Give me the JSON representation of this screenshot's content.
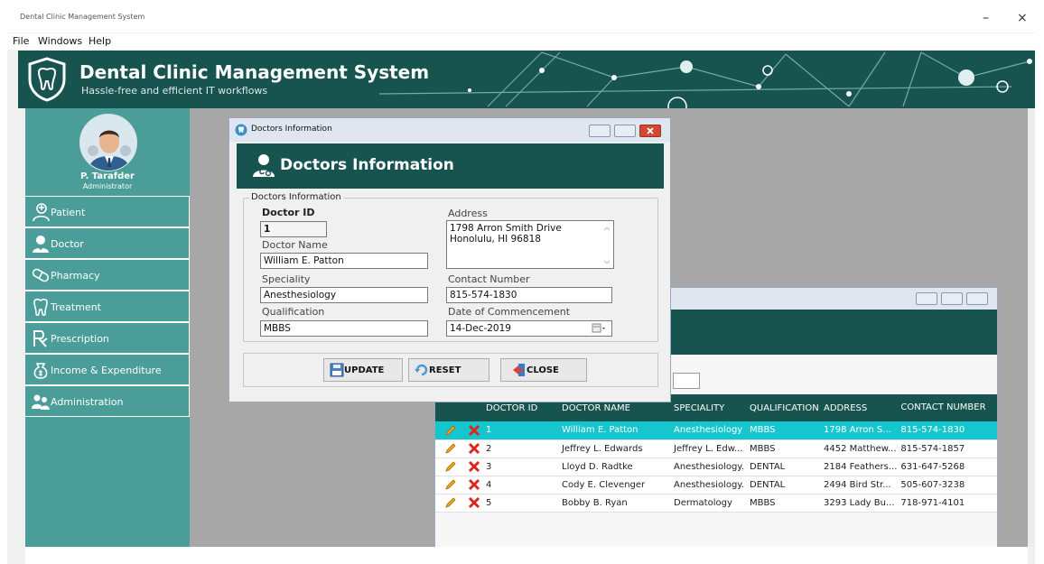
{
  "window": {
    "title": "Dental Clinic Management System",
    "minimize_glyph": "–",
    "close_glyph": "×"
  },
  "menu": {
    "items": [
      "File",
      "Windows",
      "Help"
    ]
  },
  "banner": {
    "title": "Dental Clinic Management System",
    "subtitle": "Hassle-free and efficient IT workflows",
    "logo_icon": "tooth-shield-icon"
  },
  "user": {
    "name": "P. Tarafder",
    "role": "Administrator"
  },
  "sidebar": {
    "items": [
      {
        "label": "Patient",
        "icon": "patient-icon"
      },
      {
        "label": "Doctor",
        "icon": "doctor-icon"
      },
      {
        "label": "Pharmacy",
        "icon": "pill-icon"
      },
      {
        "label": "Treatment",
        "icon": "tooth-icon"
      },
      {
        "label": "Prescription",
        "icon": "rx-icon"
      },
      {
        "label": "Income & Expenditure",
        "icon": "money-bag-icon"
      },
      {
        "label": "Administration",
        "icon": "users-admin-icon"
      }
    ]
  },
  "dialog": {
    "window_title": "Doctors Information",
    "header_title": "Doctors Information",
    "group_title": "Doctors Information",
    "fields": {
      "doctor_id": {
        "label": "Doctor ID",
        "value": "1"
      },
      "doctor_name": {
        "label": "Doctor Name",
        "value": "William E. Patton"
      },
      "speciality": {
        "label": "Speciality",
        "value": "Anesthesiology"
      },
      "qualification": {
        "label": "Qualification",
        "value": "MBBS"
      },
      "address": {
        "label": "Address",
        "line1": "1798 Arron Smith Drive",
        "line2": "Honolulu, HI 96818"
      },
      "contact_number": {
        "label": "Contact Number",
        "value": "815-574-1830"
      },
      "date_of_commencement": {
        "label": "Date of Commencement",
        "value": "14-Dec-2019"
      }
    },
    "buttons": {
      "update": "UPDATE",
      "reset": "RESET",
      "close": "CLOSE"
    }
  },
  "doctor_list": {
    "columns": [
      "DOCTOR ID",
      "DOCTOR NAME",
      "SPECIALITY",
      "QUALIFICATION",
      "ADDRESS",
      "CONTACT NUMBER"
    ],
    "rows": [
      {
        "id": "1",
        "name": "William E. Patton",
        "speciality": "Anesthesiology",
        "qualification": "MBBS",
        "address": "1798 Arron S...",
        "contact": "815-574-1830"
      },
      {
        "id": "2",
        "name": "Jeffrey L. Edwards",
        "speciality": "Jeffrey L. Edw...",
        "qualification": "MBBS",
        "address": "4452 Matthew...",
        "contact": "815-574-1857"
      },
      {
        "id": "3",
        "name": "Lloyd D. Radtke",
        "speciality": "Anesthesiology.",
        "qualification": "DENTAL",
        "address": "2184 Feathers...",
        "contact": "631-647-5268"
      },
      {
        "id": "4",
        "name": "Cody E. Clevenger",
        "speciality": "Anesthesiology.",
        "qualification": "DENTAL",
        "address": "2494 Bird Str...",
        "contact": "505-607-3238"
      },
      {
        "id": "5",
        "name": "Bobby B. Ryan",
        "speciality": "Dermatology",
        "qualification": "MBBS",
        "address": "3293 Lady Bu...",
        "contact": "718-971-4101"
      }
    ],
    "selected_index": 0
  },
  "colors": {
    "header_teal": "#17534f",
    "sidebar_teal": "#4a9d98",
    "selected_row": "#16c6cf",
    "workspace_gray": "#a7a7a7"
  }
}
